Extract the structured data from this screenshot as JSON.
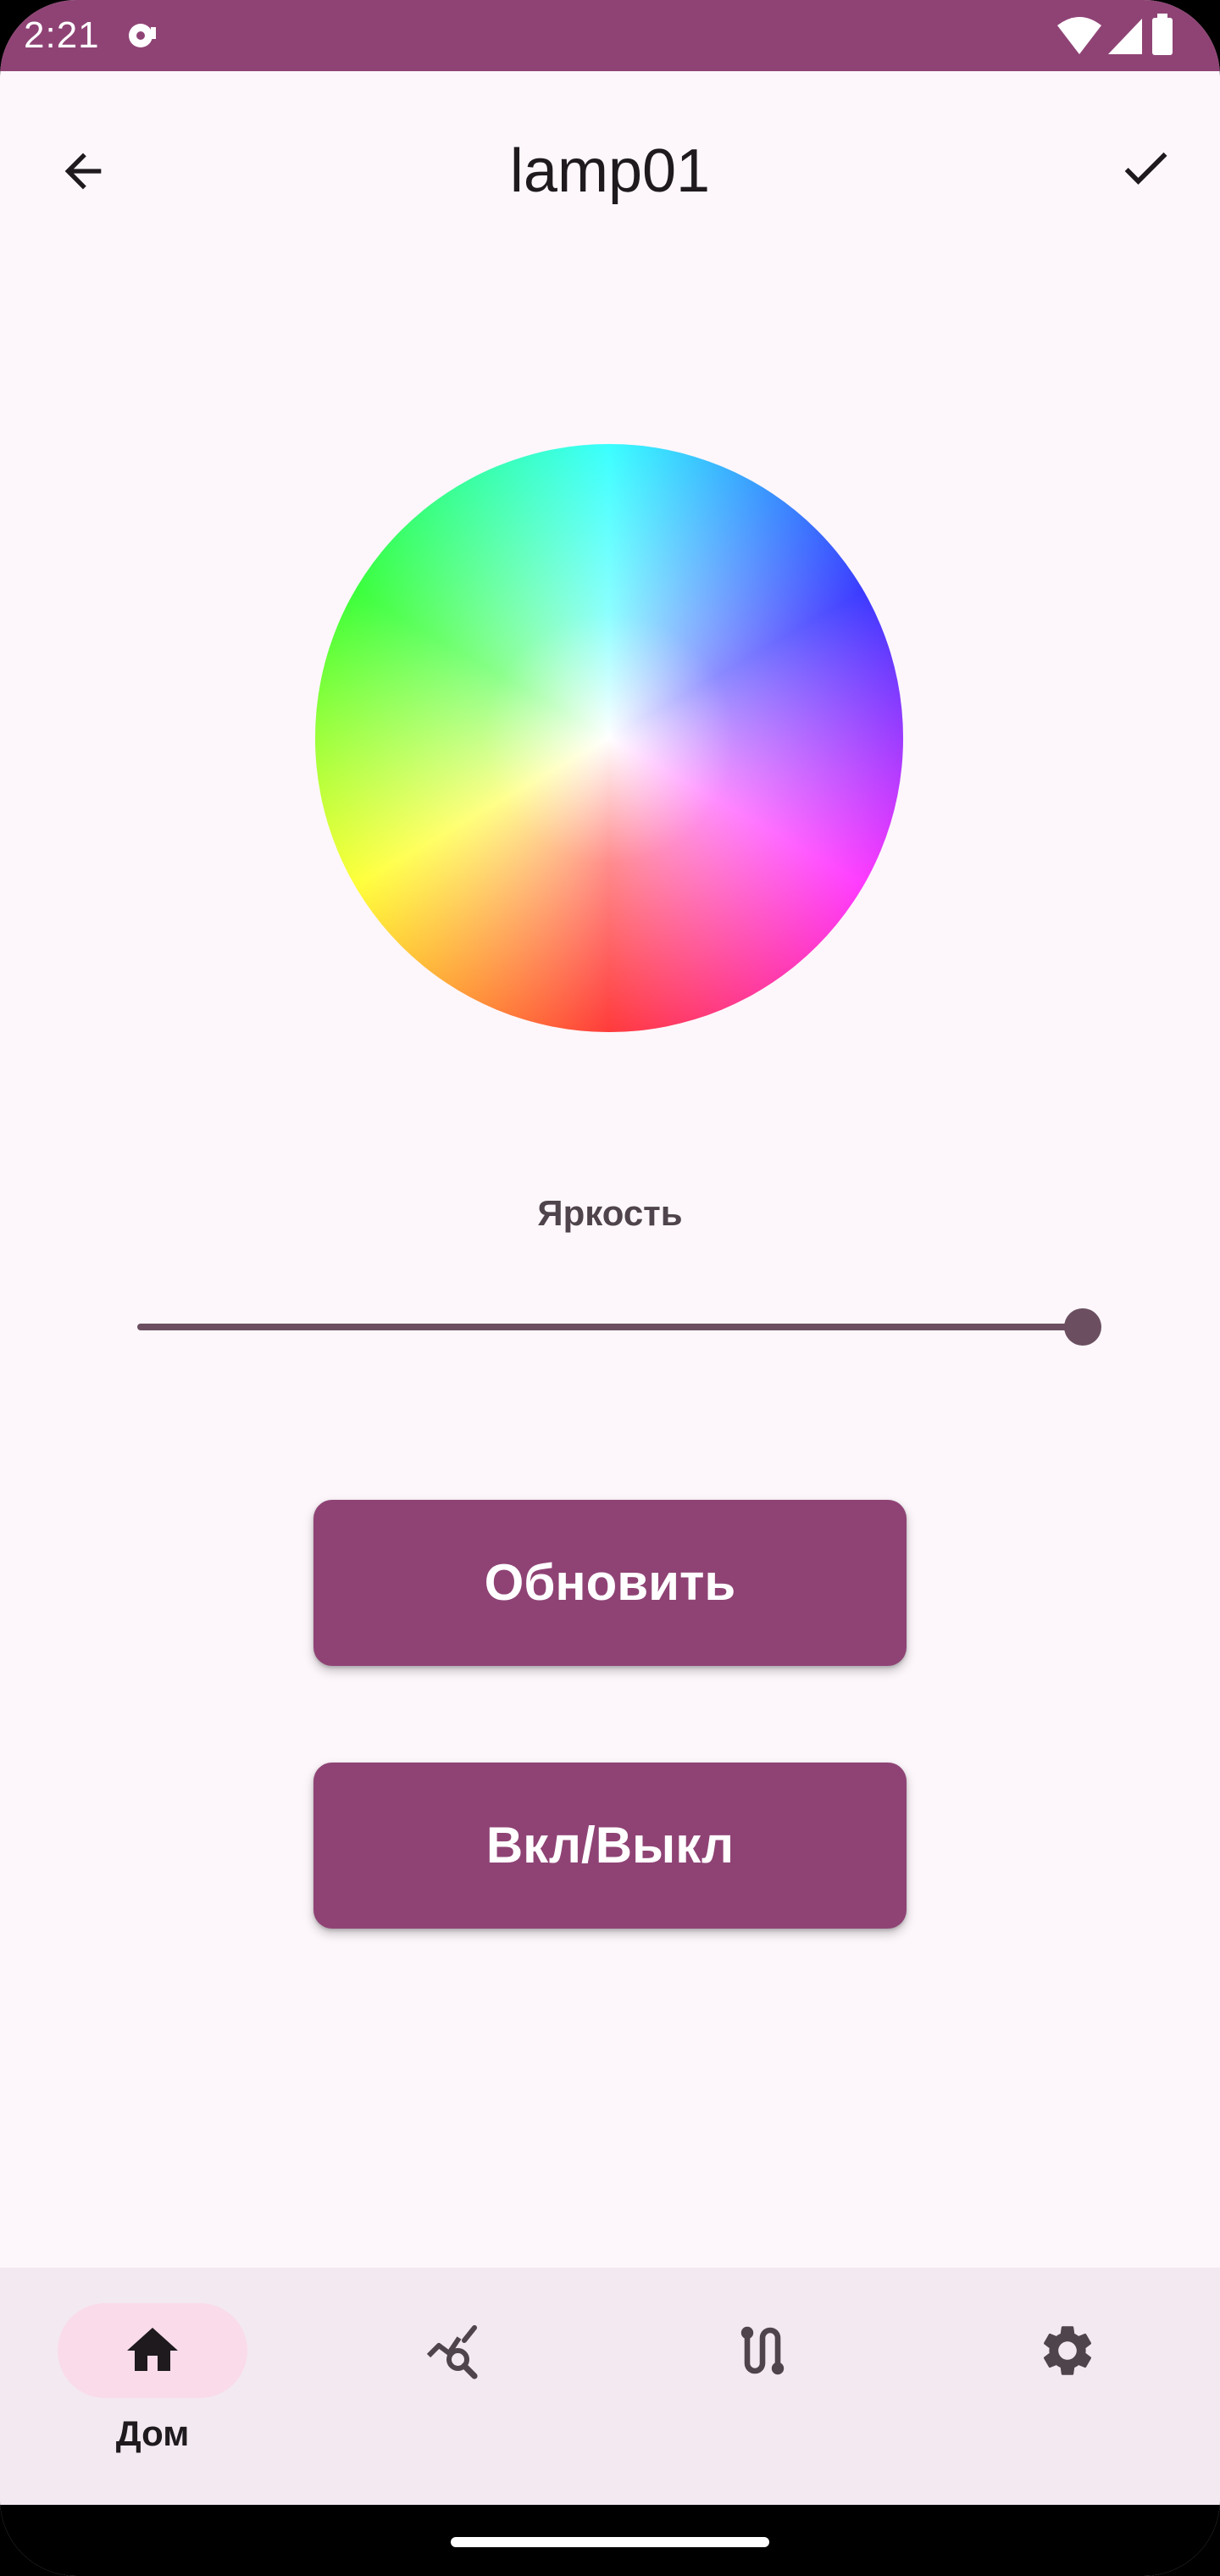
{
  "status_bar": {
    "time": "2:21",
    "background_color": "#8f4375",
    "icons": [
      "media-icon",
      "wifi-icon",
      "signal-icon",
      "battery-icon"
    ]
  },
  "app_bar": {
    "title": "lamp01",
    "back_icon": "arrow-back-icon",
    "confirm_icon": "check-icon"
  },
  "color_picker": {
    "type": "color-wheel"
  },
  "brightness": {
    "label": "Яркость",
    "value_fraction": 1.0
  },
  "actions": {
    "update_label": "Обновить",
    "toggle_label": "Вкл/Выкл"
  },
  "bottom_nav": {
    "items": [
      {
        "label": "Дом",
        "icon": "home-icon",
        "selected": true
      },
      {
        "label": "",
        "icon": "chart-search-icon",
        "selected": false
      },
      {
        "label": "",
        "icon": "route-icon",
        "selected": false
      },
      {
        "label": "",
        "icon": "gear-icon",
        "selected": false
      }
    ]
  },
  "theme": {
    "primary": "#8f4375",
    "background": "#fdf7fb",
    "nav_background": "#f3e9f1",
    "nav_indicator": "#fadbea"
  }
}
